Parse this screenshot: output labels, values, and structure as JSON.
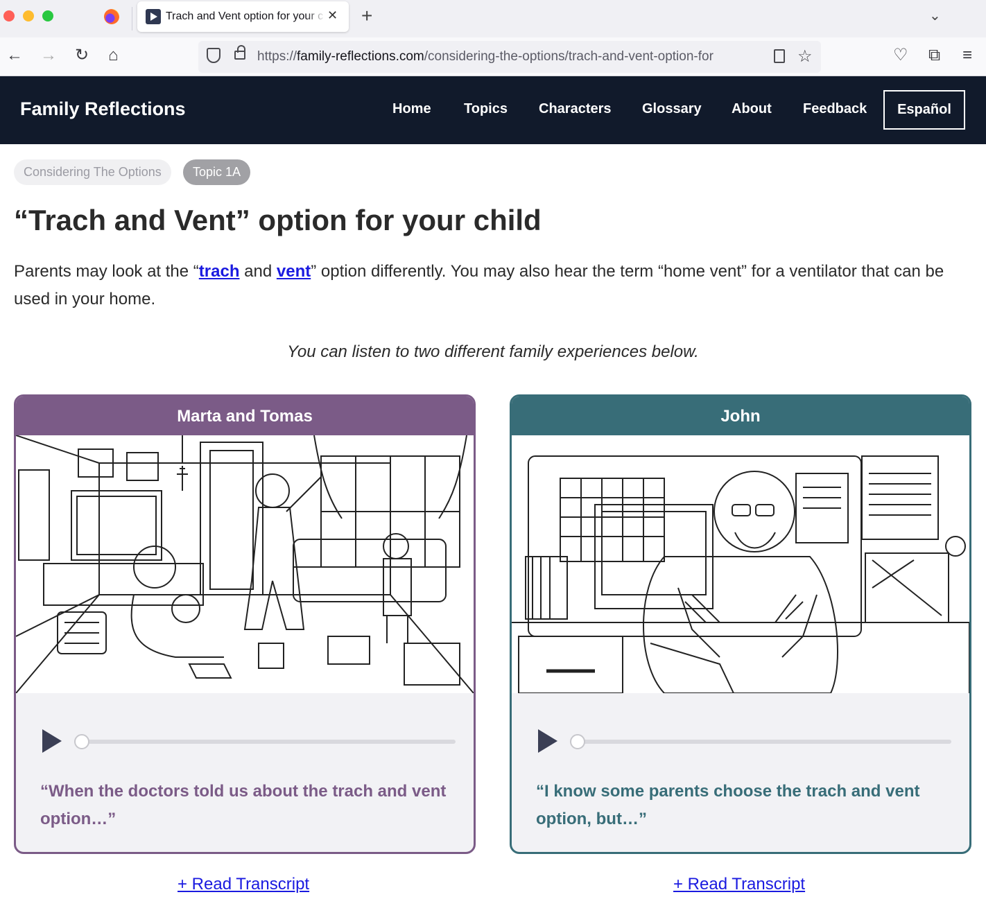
{
  "browser": {
    "tab_title": "Trach and Vent option for your c",
    "url_prefix": "https://",
    "url_host": "family-reflections.com",
    "url_path": "/considering-the-options/trach-and-vent-option-for",
    "icons": [
      "close-icon",
      "plus-icon",
      "chevron-down-icon",
      "back-icon",
      "forward-icon",
      "reload-icon",
      "home-icon",
      "shield-icon",
      "lock-icon",
      "reader-icon",
      "star-icon",
      "pocket-icon",
      "extensions-icon",
      "menu-icon"
    ]
  },
  "site": {
    "title": "Family Reflections",
    "nav": [
      "Home",
      "Topics",
      "Characters",
      "Glossary",
      "About",
      "Feedback"
    ],
    "language": "Español",
    "header_color": "#111a2b"
  },
  "breadcrumbs": [
    "Considering The Options",
    "Topic 1A"
  ],
  "page": {
    "title": "“Trach and Vent” option for your child",
    "intro_before": "Parents may look at the “",
    "intro_link1": "trach",
    "intro_mid": " and ",
    "intro_link2": "vent",
    "intro_after": "” option differently. You may also hear the term “home vent” for a ventilator that can be used in your home.",
    "listen_note": "You can listen to two different family experiences below."
  },
  "cards": [
    {
      "name": "Marta and Tomas",
      "quote": "“When the doctors told us about the trach and vent option…”",
      "color": "#7b5b87",
      "progress": 0,
      "transcript": "+ Read Transcript"
    },
    {
      "name": "John",
      "quote": "“I know some parents choose the trach and vent option, but…”",
      "color": "#386d78",
      "progress": 0,
      "transcript": "+ Read Transcript"
    }
  ]
}
